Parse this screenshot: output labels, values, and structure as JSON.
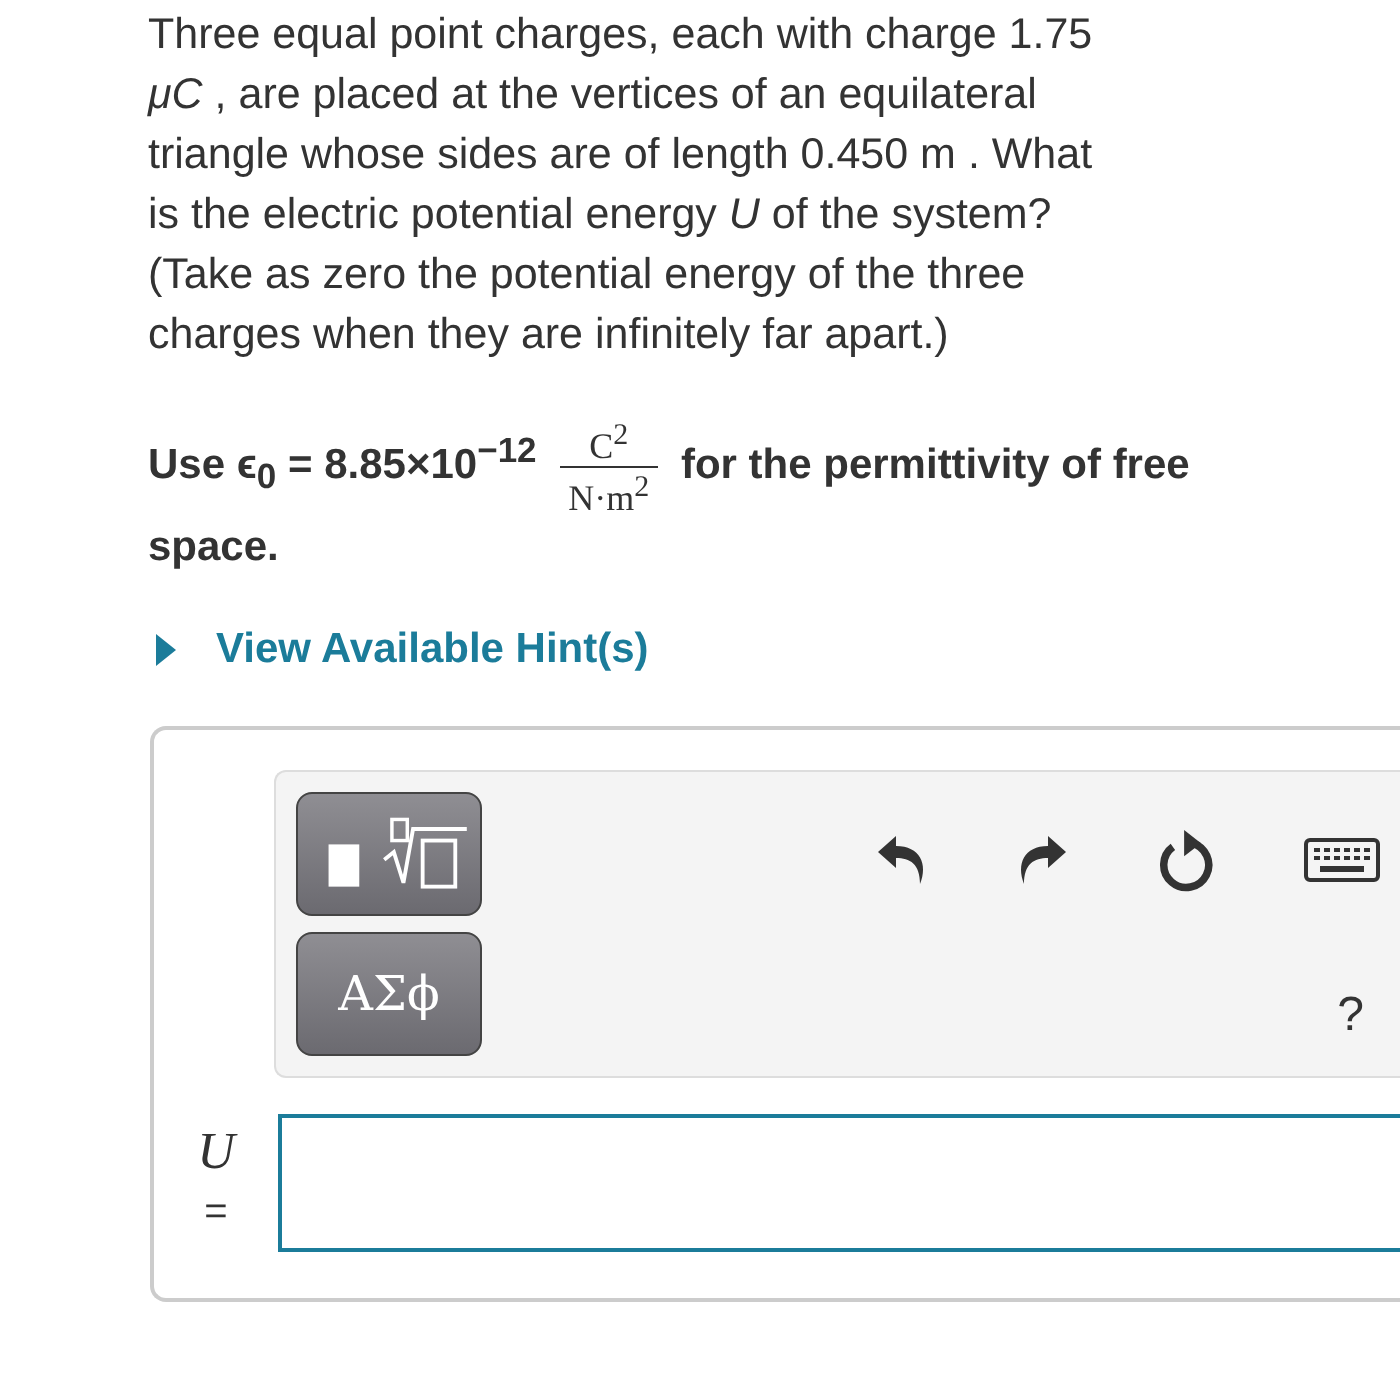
{
  "question": "Three equal point charges, each with charge 1.75 *μC* , are placed at the vertices of an equilateral triangle whose sides are of length 0.450 m . What is the electric potential energy *U* of the system? (Take as zero the potential energy of the three charges when they are infinitely far apart.)",
  "permittivity": {
    "lead": "Use ϵ$_{0}$ = 8.85×10$^{−12}$",
    "numerator": "C$^{2}$",
    "denominator": "N·m$^{2}$",
    "tail": "for the permittivity of free space."
  },
  "hint_link": "View Available Hint(s)",
  "toolbar": {
    "symbols_button": "ΑΣϕ",
    "help": "?"
  },
  "answer": {
    "label": "U",
    "equals": "="
  }
}
